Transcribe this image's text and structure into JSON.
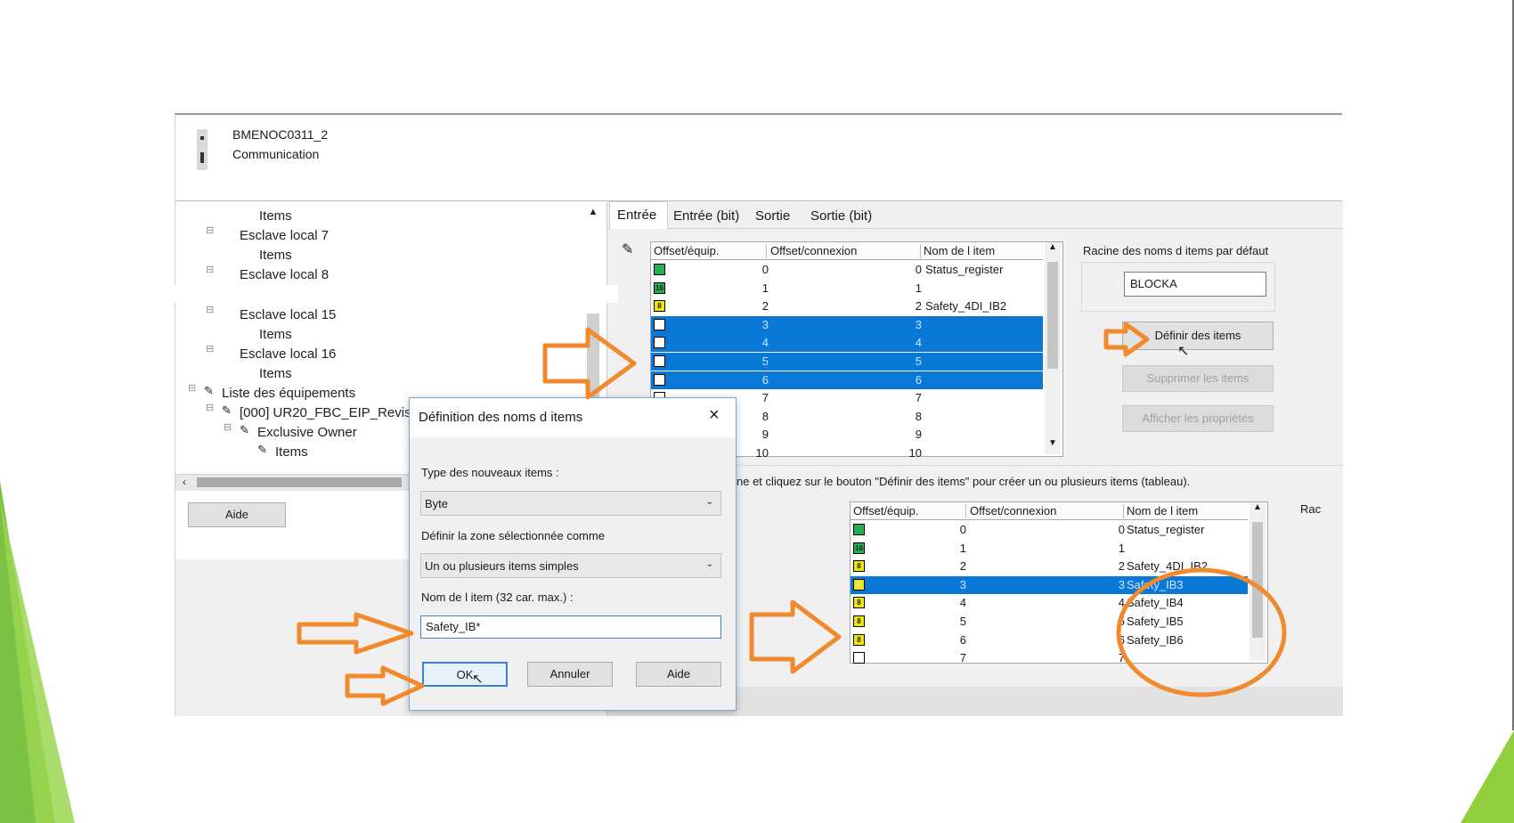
{
  "header": {
    "device_name": "BMENOC0311_2",
    "device_type": "Communication"
  },
  "tree": {
    "items": [
      {
        "label": "Items",
        "level": 2
      },
      {
        "label": "Esclave local 7",
        "level": 1
      },
      {
        "label": "Items",
        "level": 2
      },
      {
        "label": "Esclave local 8",
        "level": 1
      },
      {
        "label": "Esclave local 15",
        "level": 1
      },
      {
        "label": "Items",
        "level": 2
      },
      {
        "label": "Esclave local 16",
        "level": 1
      },
      {
        "label": "Items",
        "level": 2
      },
      {
        "label": "Liste des équipements",
        "level": 0
      },
      {
        "label": "[000] UR20_FBC_EIP_Revis",
        "level": 1
      },
      {
        "label": "Exclusive Owner",
        "level": 2
      },
      {
        "label": "Items",
        "level": 3
      }
    ],
    "help_button": "Aide"
  },
  "tabs": [
    "Entrée",
    "Entrée (bit)",
    "Sortie",
    "Sortie (bit)"
  ],
  "table_top": {
    "columns": [
      "Offset/équip.",
      "Offset/connexion",
      "Nom de l item"
    ],
    "rows": [
      {
        "badge": "",
        "dev": "0",
        "conn": "0",
        "name": "Status_register",
        "selected": false
      },
      {
        "badge": "16",
        "dev": "1",
        "conn": "1",
        "name": "",
        "selected": false
      },
      {
        "badge": "8",
        "dev": "2",
        "conn": "2",
        "name": "Safety_4DI_IB2",
        "selected": false
      },
      {
        "badge": "",
        "dev": "3",
        "conn": "3",
        "name": "",
        "selected": true
      },
      {
        "badge": "",
        "dev": "4",
        "conn": "4",
        "name": "",
        "selected": true
      },
      {
        "badge": "",
        "dev": "5",
        "conn": "5",
        "name": "",
        "selected": true
      },
      {
        "badge": "",
        "dev": "6",
        "conn": "6",
        "name": "",
        "selected": true
      },
      {
        "badge": "",
        "dev": "7",
        "conn": "7",
        "name": "",
        "selected": false
      },
      {
        "badge": "",
        "dev": "8",
        "conn": "8",
        "name": "",
        "selected": false
      },
      {
        "badge": "",
        "dev": "9",
        "conn": "9",
        "name": "",
        "selected": false
      },
      {
        "badge": "",
        "dev": "10",
        "conn": "10",
        "name": "",
        "selected": false
      }
    ]
  },
  "right_panel": {
    "root_label": "Racine des noms d items par défaut",
    "root_value": "BLOCKA",
    "define_button": "Définir des items",
    "delete_button": "Supprimer les items",
    "props_button": "Afficher les propriétés"
  },
  "hint_text": "ne et cliquez sur le bouton \"Définir des items\" pour créer un ou plusieurs items (tableau).",
  "table_bottom": {
    "columns": [
      "Offset/équip.",
      "Offset/connexion",
      "Nom de l item"
    ],
    "side_label": "Rac",
    "rows": [
      {
        "badge": "",
        "dev": "0",
        "conn": "0",
        "name": "Status_register",
        "selected": false
      },
      {
        "badge": "16",
        "dev": "1",
        "conn": "1",
        "name": "",
        "selected": false
      },
      {
        "badge": "8",
        "dev": "2",
        "conn": "2",
        "name": "Safety_4DI_IB2",
        "selected": false
      },
      {
        "badge": "8",
        "dev": "3",
        "conn": "3",
        "name": "Safety_IB3",
        "selected": true
      },
      {
        "badge": "8",
        "dev": "4",
        "conn": "4",
        "name": "Safety_IB4",
        "selected": false
      },
      {
        "badge": "8",
        "dev": "5",
        "conn": "5",
        "name": "Safety_IB5",
        "selected": false
      },
      {
        "badge": "8",
        "dev": "6",
        "conn": "6",
        "name": "Safety_IB6",
        "selected": false
      },
      {
        "badge": "",
        "dev": "7",
        "conn": "7",
        "name": "",
        "selected": false
      }
    ]
  },
  "dialog": {
    "title": "Définition des noms d items",
    "type_label": "Type des nouveaux items :",
    "type_value": "Byte",
    "zone_label": "Définir la zone sélectionnée comme",
    "zone_value": "Un ou plusieurs items simples",
    "name_label": "Nom de l item (32 car. max.) :",
    "name_value": "Safety_IB*",
    "ok": "OK",
    "cancel": "Annuler",
    "help": "Aide"
  },
  "colors": {
    "accent_orange": "#f08a2c",
    "selection_blue": "#0a78d7",
    "slide_green": "#8fce3c",
    "badge_green": "#22b14c",
    "badge_yellow": "#f2e600"
  }
}
